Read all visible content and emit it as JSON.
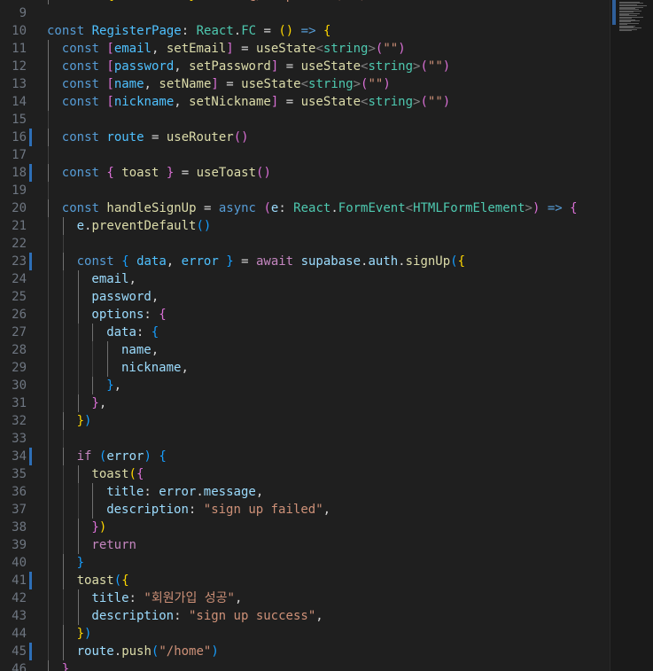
{
  "editor": {
    "language": "typescript-react",
    "first_visible_line": 8,
    "lines": [
      {
        "n": "8",
        "indent": 1,
        "tokens": [
          [
            "t-kw",
            "const"
          ],
          [
            "t-punc",
            " "
          ],
          [
            "t-b1",
            "{"
          ],
          [
            "t-punc",
            " "
          ],
          [
            "t-var",
            "useToast"
          ],
          [
            "t-punc",
            " "
          ],
          [
            "t-b1",
            "}"
          ],
          [
            "t-punc",
            " "
          ],
          [
            "t-ctl",
            "from"
          ],
          [
            "t-punc",
            " "
          ],
          [
            "t-str",
            "\"@/components/ui/use-toast\""
          ]
        ]
      },
      {
        "n": "9",
        "indent": 0,
        "tokens": []
      },
      {
        "n": "10",
        "indent": 0,
        "tokens": [
          [
            "t-kw",
            "const"
          ],
          [
            "t-punc",
            " "
          ],
          [
            "t-const",
            "RegisterPage"
          ],
          [
            "t-punc",
            ": "
          ],
          [
            "t-type",
            "React"
          ],
          [
            "t-punc",
            "."
          ],
          [
            "t-type",
            "FC"
          ],
          [
            "t-punc",
            " = "
          ],
          [
            "t-b1",
            "()"
          ],
          [
            "t-punc",
            " "
          ],
          [
            "t-kw",
            "=>"
          ],
          [
            "t-punc",
            " "
          ],
          [
            "t-b1",
            "{"
          ]
        ]
      },
      {
        "n": "11",
        "indent": 1,
        "tokens": [
          [
            "t-kw",
            "const"
          ],
          [
            "t-punc",
            " "
          ],
          [
            "t-b2",
            "["
          ],
          [
            "t-const",
            "email"
          ],
          [
            "t-punc",
            ", "
          ],
          [
            "t-fn",
            "setEmail"
          ],
          [
            "t-b2",
            "]"
          ],
          [
            "t-punc",
            " = "
          ],
          [
            "t-fn",
            "useState"
          ],
          [
            "t-tag",
            "<"
          ],
          [
            "t-type",
            "string"
          ],
          [
            "t-tag",
            ">"
          ],
          [
            "t-b2",
            "("
          ],
          [
            "t-str",
            "\"\""
          ],
          [
            "t-b2",
            ")"
          ]
        ]
      },
      {
        "n": "12",
        "indent": 1,
        "tokens": [
          [
            "t-kw",
            "const"
          ],
          [
            "t-punc",
            " "
          ],
          [
            "t-b2",
            "["
          ],
          [
            "t-const",
            "password"
          ],
          [
            "t-punc",
            ", "
          ],
          [
            "t-fn",
            "setPassword"
          ],
          [
            "t-b2",
            "]"
          ],
          [
            "t-punc",
            " = "
          ],
          [
            "t-fn",
            "useState"
          ],
          [
            "t-tag",
            "<"
          ],
          [
            "t-type",
            "string"
          ],
          [
            "t-tag",
            ">"
          ],
          [
            "t-b2",
            "("
          ],
          [
            "t-str",
            "\"\""
          ],
          [
            "t-b2",
            ")"
          ]
        ]
      },
      {
        "n": "13",
        "indent": 1,
        "tokens": [
          [
            "t-kw",
            "const"
          ],
          [
            "t-punc",
            " "
          ],
          [
            "t-b2",
            "["
          ],
          [
            "t-const",
            "name"
          ],
          [
            "t-punc",
            ", "
          ],
          [
            "t-fn",
            "setName"
          ],
          [
            "t-b2",
            "]"
          ],
          [
            "t-punc",
            " = "
          ],
          [
            "t-fn",
            "useState"
          ],
          [
            "t-tag",
            "<"
          ],
          [
            "t-type",
            "string"
          ],
          [
            "t-tag",
            ">"
          ],
          [
            "t-b2",
            "("
          ],
          [
            "t-str",
            "\"\""
          ],
          [
            "t-b2",
            ")"
          ]
        ]
      },
      {
        "n": "14",
        "indent": 1,
        "tokens": [
          [
            "t-kw",
            "const"
          ],
          [
            "t-punc",
            " "
          ],
          [
            "t-b2",
            "["
          ],
          [
            "t-const",
            "nickname"
          ],
          [
            "t-punc",
            ", "
          ],
          [
            "t-fn",
            "setNickname"
          ],
          [
            "t-b2",
            "]"
          ],
          [
            "t-punc",
            " = "
          ],
          [
            "t-fn",
            "useState"
          ],
          [
            "t-tag",
            "<"
          ],
          [
            "t-type",
            "string"
          ],
          [
            "t-tag",
            ">"
          ],
          [
            "t-b2",
            "("
          ],
          [
            "t-str",
            "\"\""
          ],
          [
            "t-b2",
            ")"
          ]
        ]
      },
      {
        "n": "15",
        "indent": 1,
        "tokens": []
      },
      {
        "n": "16",
        "indent": 1,
        "bar": true,
        "tokens": [
          [
            "t-kw",
            "const"
          ],
          [
            "t-punc",
            " "
          ],
          [
            "t-const",
            "route"
          ],
          [
            "t-punc",
            " = "
          ],
          [
            "t-fn",
            "useRouter"
          ],
          [
            "t-b2",
            "()"
          ]
        ]
      },
      {
        "n": "17",
        "indent": 1,
        "tokens": []
      },
      {
        "n": "18",
        "indent": 1,
        "bar": true,
        "tokens": [
          [
            "t-kw",
            "const"
          ],
          [
            "t-punc",
            " "
          ],
          [
            "t-b2",
            "{"
          ],
          [
            "t-punc",
            " "
          ],
          [
            "t-fn",
            "toast"
          ],
          [
            "t-punc",
            " "
          ],
          [
            "t-b2",
            "}"
          ],
          [
            "t-punc",
            " = "
          ],
          [
            "t-fn",
            "useToast"
          ],
          [
            "t-b2",
            "()"
          ]
        ]
      },
      {
        "n": "19",
        "indent": 1,
        "tokens": []
      },
      {
        "n": "20",
        "indent": 1,
        "tokens": [
          [
            "t-kw",
            "const"
          ],
          [
            "t-punc",
            " "
          ],
          [
            "t-fn",
            "handleSignUp"
          ],
          [
            "t-punc",
            " = "
          ],
          [
            "t-kw",
            "async"
          ],
          [
            "t-punc",
            " "
          ],
          [
            "t-b2",
            "("
          ],
          [
            "t-var",
            "e"
          ],
          [
            "t-punc",
            ": "
          ],
          [
            "t-type",
            "React"
          ],
          [
            "t-punc",
            "."
          ],
          [
            "t-type",
            "FormEvent"
          ],
          [
            "t-tag",
            "<"
          ],
          [
            "t-type",
            "HTMLFormElement"
          ],
          [
            "t-tag",
            ">"
          ],
          [
            "t-b2",
            ")"
          ],
          [
            "t-punc",
            " "
          ],
          [
            "t-kw",
            "=>"
          ],
          [
            "t-punc",
            " "
          ],
          [
            "t-b2",
            "{"
          ]
        ]
      },
      {
        "n": "21",
        "indent": 2,
        "tokens": [
          [
            "t-var",
            "e"
          ],
          [
            "t-punc",
            "."
          ],
          [
            "t-fn",
            "preventDefault"
          ],
          [
            "t-b3",
            "()"
          ]
        ]
      },
      {
        "n": "22",
        "indent": 2,
        "tokens": []
      },
      {
        "n": "23",
        "indent": 2,
        "bar": true,
        "tokens": [
          [
            "t-kw",
            "const"
          ],
          [
            "t-punc",
            " "
          ],
          [
            "t-b3",
            "{"
          ],
          [
            "t-punc",
            " "
          ],
          [
            "t-const",
            "data"
          ],
          [
            "t-punc",
            ", "
          ],
          [
            "t-const",
            "error"
          ],
          [
            "t-punc",
            " "
          ],
          [
            "t-b3",
            "}"
          ],
          [
            "t-punc",
            " = "
          ],
          [
            "t-ctl",
            "await"
          ],
          [
            "t-punc",
            " "
          ],
          [
            "t-var",
            "supabase"
          ],
          [
            "t-punc",
            "."
          ],
          [
            "t-var",
            "auth"
          ],
          [
            "t-punc",
            "."
          ],
          [
            "t-fn",
            "signUp"
          ],
          [
            "t-b3",
            "("
          ],
          [
            "t-b1",
            "{"
          ]
        ]
      },
      {
        "n": "24",
        "indent": 3,
        "tokens": [
          [
            "t-var",
            "email"
          ],
          [
            "t-punc",
            ","
          ]
        ]
      },
      {
        "n": "25",
        "indent": 3,
        "tokens": [
          [
            "t-var",
            "password"
          ],
          [
            "t-punc",
            ","
          ]
        ]
      },
      {
        "n": "26",
        "indent": 3,
        "tokens": [
          [
            "t-var",
            "options"
          ],
          [
            "t-punc",
            ": "
          ],
          [
            "t-b2",
            "{"
          ]
        ]
      },
      {
        "n": "27",
        "indent": 4,
        "tokens": [
          [
            "t-var",
            "data"
          ],
          [
            "t-punc",
            ": "
          ],
          [
            "t-b3",
            "{"
          ]
        ]
      },
      {
        "n": "28",
        "indent": 5,
        "tokens": [
          [
            "t-var",
            "name"
          ],
          [
            "t-punc",
            ","
          ]
        ]
      },
      {
        "n": "29",
        "indent": 5,
        "tokens": [
          [
            "t-var",
            "nickname"
          ],
          [
            "t-punc",
            ","
          ]
        ]
      },
      {
        "n": "30",
        "indent": 4,
        "tokens": [
          [
            "t-b3",
            "}"
          ],
          [
            "t-punc",
            ","
          ]
        ]
      },
      {
        "n": "31",
        "indent": 3,
        "tokens": [
          [
            "t-b2",
            "}"
          ],
          [
            "t-punc",
            ","
          ]
        ]
      },
      {
        "n": "32",
        "indent": 2,
        "tokens": [
          [
            "t-b1",
            "}"
          ],
          [
            "t-b3",
            ")"
          ]
        ]
      },
      {
        "n": "33",
        "indent": 2,
        "tokens": []
      },
      {
        "n": "34",
        "indent": 2,
        "bar": true,
        "tokens": [
          [
            "t-ctl",
            "if"
          ],
          [
            "t-punc",
            " "
          ],
          [
            "t-b3",
            "("
          ],
          [
            "t-var",
            "error"
          ],
          [
            "t-b3",
            ")"
          ],
          [
            "t-punc",
            " "
          ],
          [
            "t-b3",
            "{"
          ]
        ]
      },
      {
        "n": "35",
        "indent": 3,
        "tokens": [
          [
            "t-fn",
            "toast"
          ],
          [
            "t-b1",
            "("
          ],
          [
            "t-b2",
            "{"
          ]
        ]
      },
      {
        "n": "36",
        "indent": 4,
        "tokens": [
          [
            "t-var",
            "title"
          ],
          [
            "t-punc",
            ": "
          ],
          [
            "t-var",
            "error"
          ],
          [
            "t-punc",
            "."
          ],
          [
            "t-var",
            "message"
          ],
          [
            "t-punc",
            ","
          ]
        ]
      },
      {
        "n": "37",
        "indent": 4,
        "tokens": [
          [
            "t-var",
            "description"
          ],
          [
            "t-punc",
            ": "
          ],
          [
            "t-str",
            "\"sign up failed\""
          ],
          [
            "t-punc",
            ","
          ]
        ]
      },
      {
        "n": "38",
        "indent": 3,
        "tokens": [
          [
            "t-b2",
            "}"
          ],
          [
            "t-b1",
            ")"
          ]
        ]
      },
      {
        "n": "39",
        "indent": 3,
        "tokens": [
          [
            "t-ctl",
            "return"
          ]
        ]
      },
      {
        "n": "40",
        "indent": 2,
        "tokens": [
          [
            "t-b3",
            "}"
          ]
        ]
      },
      {
        "n": "41",
        "indent": 2,
        "bar": true,
        "tokens": [
          [
            "t-fn",
            "toast"
          ],
          [
            "t-b3",
            "("
          ],
          [
            "t-b1",
            "{"
          ]
        ]
      },
      {
        "n": "42",
        "indent": 3,
        "tokens": [
          [
            "t-var",
            "title"
          ],
          [
            "t-punc",
            ": "
          ],
          [
            "t-str",
            "\"회원가입 성공\""
          ],
          [
            "t-punc",
            ","
          ]
        ]
      },
      {
        "n": "43",
        "indent": 3,
        "tokens": [
          [
            "t-var",
            "description"
          ],
          [
            "t-punc",
            ": "
          ],
          [
            "t-str",
            "\"sign up success\""
          ],
          [
            "t-punc",
            ","
          ]
        ]
      },
      {
        "n": "44",
        "indent": 2,
        "tokens": [
          [
            "t-b1",
            "}"
          ],
          [
            "t-b3",
            ")"
          ]
        ]
      },
      {
        "n": "45",
        "indent": 2,
        "bar": true,
        "tokens": [
          [
            "t-var",
            "route"
          ],
          [
            "t-punc",
            "."
          ],
          [
            "t-fn",
            "push"
          ],
          [
            "t-b3",
            "("
          ],
          [
            "t-str",
            "\"/home\""
          ],
          [
            "t-b3",
            ")"
          ]
        ]
      },
      {
        "n": "46",
        "indent": 1,
        "tokens": [
          [
            "t-b2",
            "}"
          ]
        ]
      }
    ]
  }
}
